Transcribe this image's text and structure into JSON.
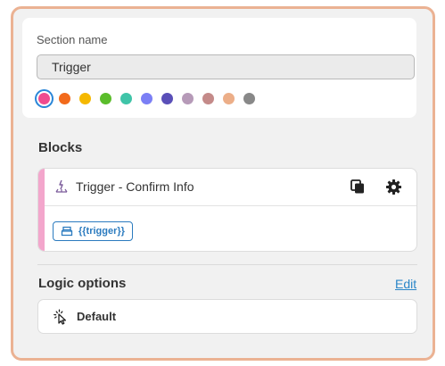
{
  "section": {
    "label": "Section name",
    "name_value": "Trigger",
    "colors": [
      "#ef4b8f",
      "#f26a1b",
      "#f5b800",
      "#5bbd2b",
      "#3fc4a8",
      "#7b7ff5",
      "#5a4fb8",
      "#b69ab8",
      "#c48a89",
      "#ecae88",
      "#888888"
    ],
    "selected_color": "#ef4b8f"
  },
  "blocks": {
    "title": "Blocks",
    "items": [
      {
        "title": "Trigger - Confirm Info",
        "accent": "#f3a6cc",
        "icon": "trigger-icon",
        "actions": [
          "copy-icon",
          "gear-icon",
          "close-icon"
        ],
        "tag": "{{trigger}}",
        "tag_icon": "database-icon"
      }
    ]
  },
  "logic": {
    "title": "Logic options",
    "edit_label": "Edit",
    "default_label": "Default",
    "default_icon": "click-icon"
  },
  "colors": {
    "frame_border": "#ebb293",
    "link": "#2a86c8",
    "tag": "#2b7bbf",
    "delete": "#c0121b"
  }
}
